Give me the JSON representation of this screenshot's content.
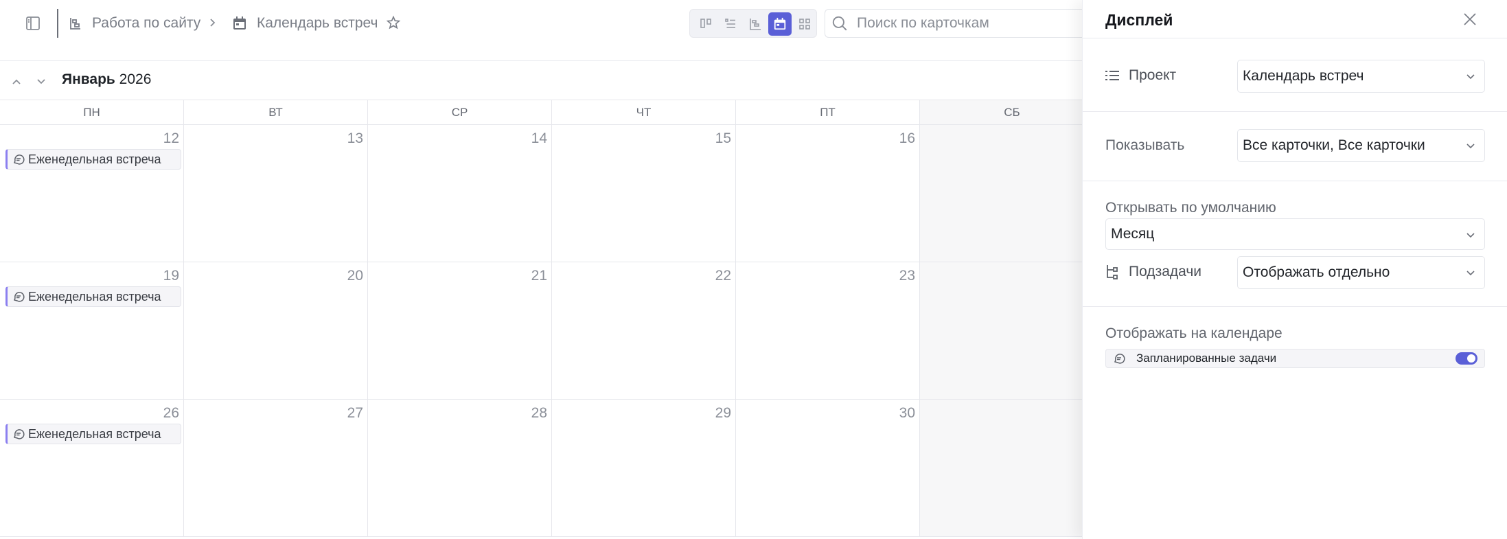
{
  "breadcrumb": {
    "project": "Работа по сайту",
    "page": "Календарь встреч"
  },
  "search": {
    "placeholder": "Поиск по карточкам"
  },
  "calendar": {
    "month": "Январь",
    "year": "2026",
    "weekdays": [
      "ПН",
      "ВТ",
      "СР",
      "ЧТ",
      "ПТ",
      "СБ"
    ],
    "weeks": [
      {
        "days": [
          "12",
          "13",
          "14",
          "15",
          "16",
          ""
        ],
        "event": "Еженедельная встреча"
      },
      {
        "days": [
          "19",
          "20",
          "21",
          "22",
          "23",
          ""
        ],
        "event": "Еженедельная встреча"
      },
      {
        "days": [
          "26",
          "27",
          "28",
          "29",
          "30",
          ""
        ],
        "event": "Еженедельная встреча"
      }
    ]
  },
  "panel": {
    "title": "Дисплей",
    "project_label": "Проект",
    "project_value": "Календарь встреч",
    "show_label": "Показывать",
    "show_value": "Все карточки, Все карточки",
    "open_default_label": "Открывать по умолчанию",
    "open_default_value": "Месяц",
    "subtasks_label": "Подзадачи",
    "subtasks_value": "Отображать отдельно",
    "display_on_calendar_label": "Отображать на календаре",
    "scheduled_tasks_label": "Запланированные задачи",
    "scheduled_tasks_enabled": true
  },
  "colors": {
    "accent": "#5a5fd7",
    "event_border": "#8b7ff0"
  },
  "icons": {
    "sidebar": "sidebar-toggle-icon",
    "project": "project-tree-icon",
    "calendar": "calendar-icon",
    "star": "star-icon",
    "search": "search-icon",
    "close": "close-icon",
    "list": "list-icon",
    "subtasks": "subtasks-icon",
    "event": "chat-bubble-icon"
  }
}
